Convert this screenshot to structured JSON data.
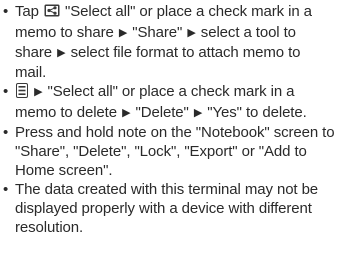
{
  "bullet_char": "•",
  "arrow_char": "▶",
  "notes": [
    {
      "t1": "Tap",
      "icon": "share-icon",
      "t2": "\"Select all\" or place a check mark in a memo to share",
      "t3": "\"Share\"",
      "t4": "select a tool to share",
      "t5": "select file format to attach memo to mail."
    },
    {
      "icon": "menu-icon",
      "t2": "\"Select all\" or place a check mark in a memo to delete",
      "t3": "\"Delete\"",
      "t4": "\"Yes\" to delete."
    },
    {
      "text": "Press and hold note on the \"Notebook\" screen to \"Share\", \"Delete\", \"Lock\", \"Export\" or \"Add to Home screen\"."
    },
    {
      "text": "The data created with this terminal may not be displayed properly with a device with different resolution."
    }
  ]
}
